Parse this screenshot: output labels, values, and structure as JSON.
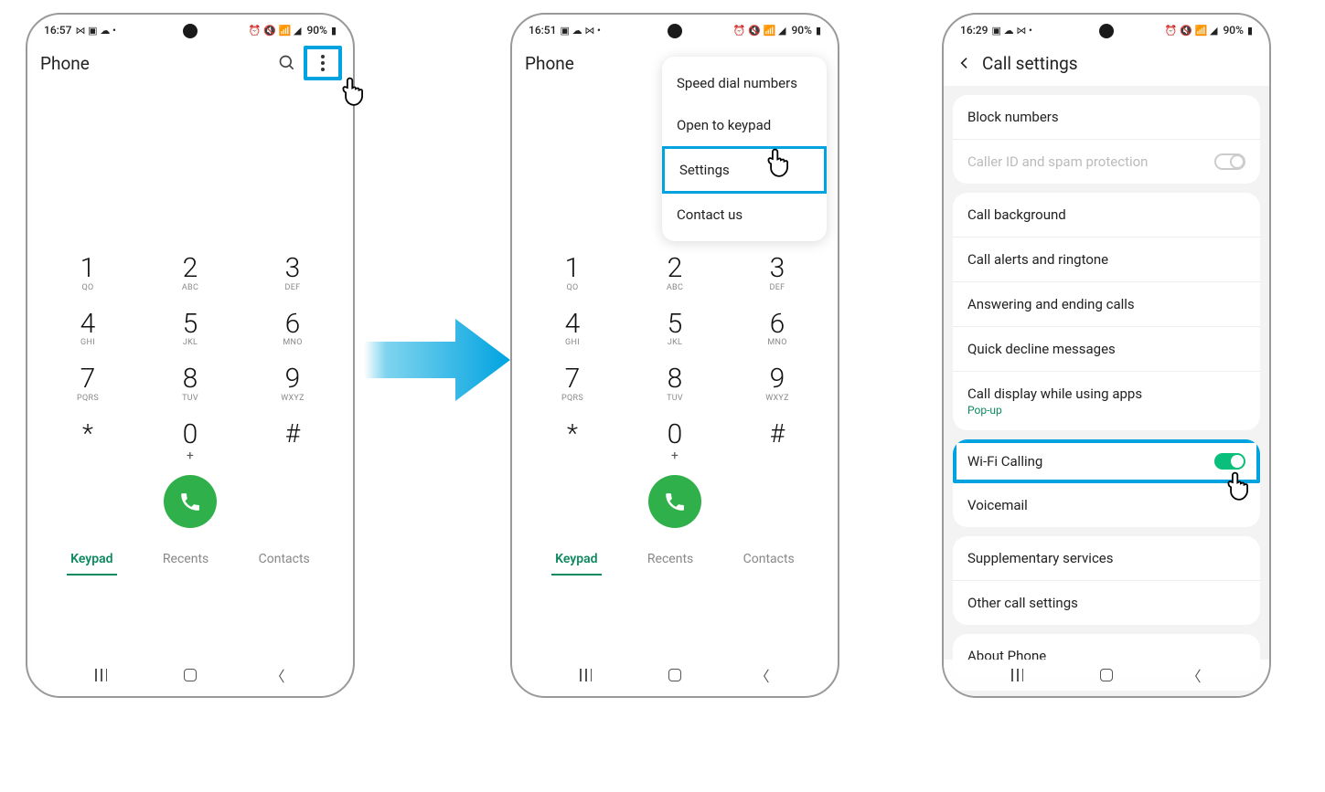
{
  "status": {
    "p1_time": "16:57",
    "p2_time": "16:51",
    "p3_time": "16:29",
    "battery": "90%"
  },
  "phoneApp": {
    "title": "Phone",
    "tabs": {
      "keypad": "Keypad",
      "recents": "Recents",
      "contacts": "Contacts"
    }
  },
  "keypad": {
    "keys": [
      [
        {
          "d": "1",
          "s": "QO"
        },
        {
          "d": "2",
          "s": "ABC"
        },
        {
          "d": "3",
          "s": "DEF"
        }
      ],
      [
        {
          "d": "4",
          "s": "GHI"
        },
        {
          "d": "5",
          "s": "JKL"
        },
        {
          "d": "6",
          "s": "MNO"
        }
      ],
      [
        {
          "d": "7",
          "s": "PQRS"
        },
        {
          "d": "8",
          "s": "TUV"
        },
        {
          "d": "9",
          "s": "WXYZ"
        }
      ],
      [
        {
          "d": "*",
          "s": ""
        },
        {
          "d": "0",
          "s": "+"
        },
        {
          "d": "#",
          "s": ""
        }
      ]
    ]
  },
  "menu": {
    "speed_dial": "Speed dial numbers",
    "open_keypad": "Open to keypad",
    "settings": "Settings",
    "contact_us": "Contact us"
  },
  "settings": {
    "title": "Call settings",
    "block_numbers": "Block numbers",
    "caller_id": "Caller ID and spam protection",
    "call_background": "Call background",
    "alerts": "Call alerts and ringtone",
    "answering": "Answering and ending calls",
    "quick_decline": "Quick decline messages",
    "call_display": "Call display while using apps",
    "call_display_sub": "Pop-up",
    "wifi_calling": "Wi-Fi Calling",
    "voicemail": "Voicemail",
    "supplementary": "Supplementary services",
    "other": "Other call settings",
    "about": "About Phone"
  }
}
